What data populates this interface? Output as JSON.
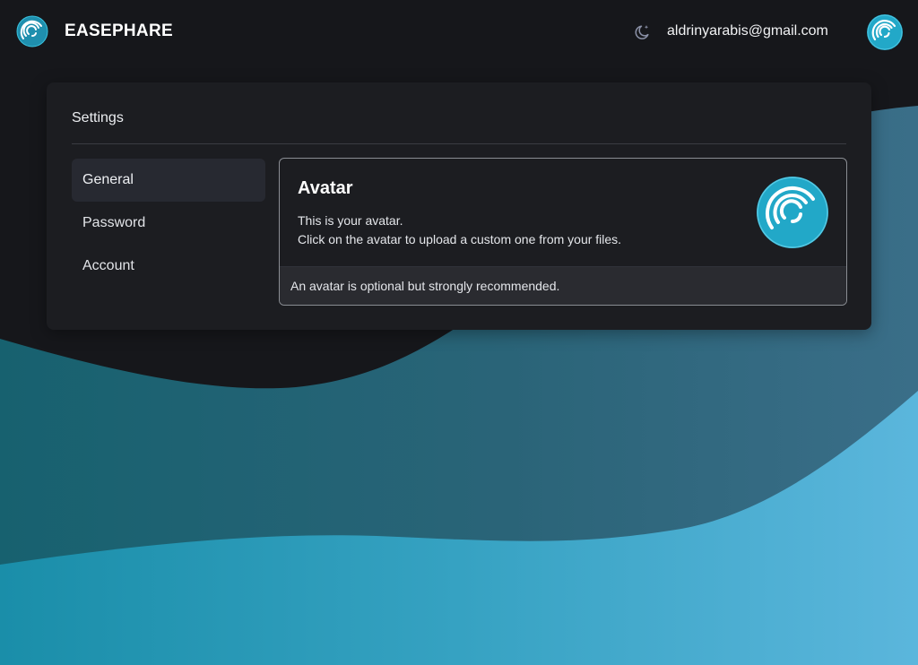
{
  "header": {
    "brand_name": "EASEPHARE",
    "logo_icon": "fingerprint-icon",
    "theme_toggle_icon": "moon-stars-icon",
    "user_email": "aldrinyarabis@gmail.com",
    "user_avatar_icon": "fingerprint-icon"
  },
  "settings": {
    "title": "Settings",
    "nav": [
      {
        "label": "General",
        "active": true
      },
      {
        "label": "Password",
        "active": false
      },
      {
        "label": "Account",
        "active": false
      }
    ],
    "avatar_section": {
      "title": "Avatar",
      "description_line1": "This is your avatar.",
      "description_line2": "Click on the avatar to upload a custom one from your files.",
      "footer_note": "An avatar is optional but strongly recommended.",
      "avatar_icon": "fingerprint-icon"
    }
  },
  "colors": {
    "page_background": "#16171b",
    "card_background": "#1c1d21",
    "accent": "#24a5c4",
    "wave_light": "#58b3d8",
    "wave_mid": "#2c6a80",
    "wave_dark": "#17616f"
  }
}
